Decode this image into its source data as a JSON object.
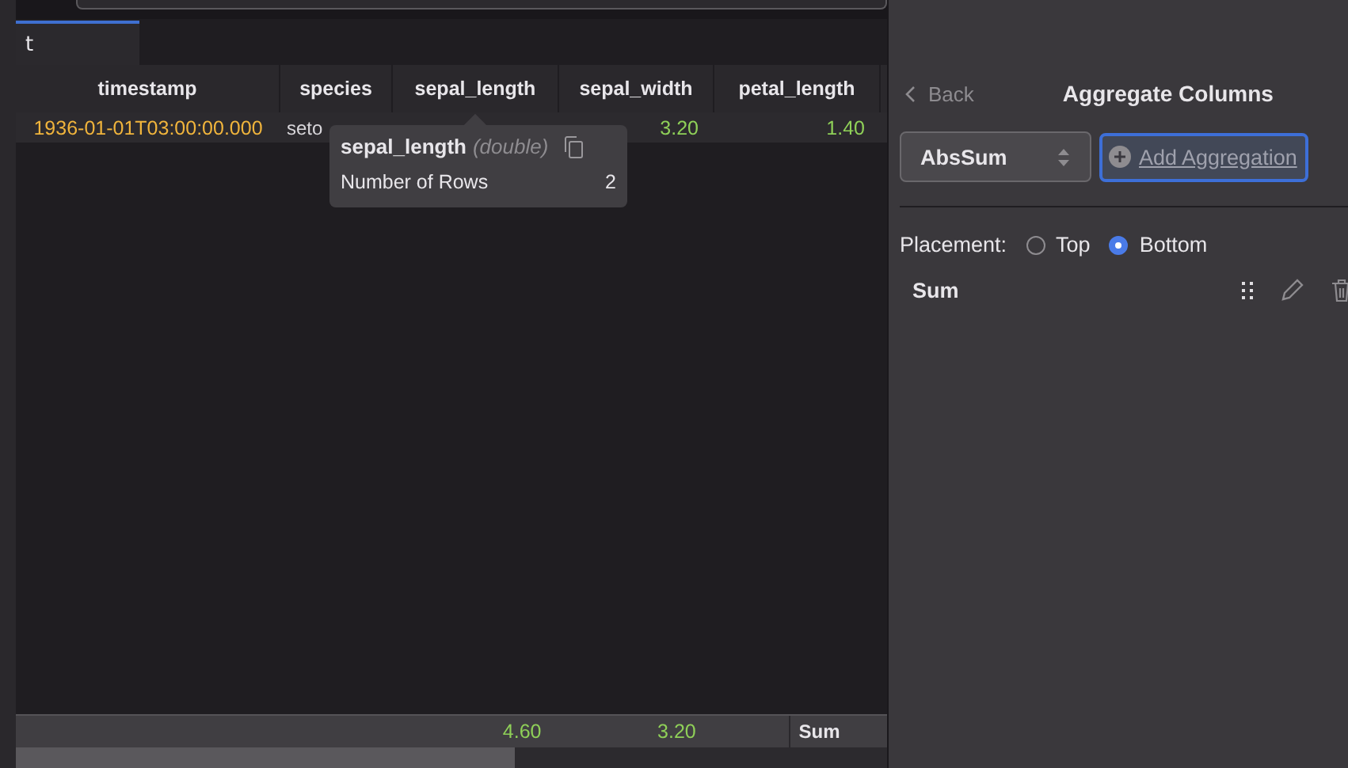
{
  "tabs": [
    {
      "label": "t",
      "selected": true
    }
  ],
  "table": {
    "columns": [
      {
        "label": "timestamp"
      },
      {
        "label": "species"
      },
      {
        "label": "sepal_length"
      },
      {
        "label": "sepal_width"
      },
      {
        "label": "petal_length"
      }
    ],
    "rows": [
      {
        "cells": [
          {
            "kind": "datetime",
            "text": "1936-01-01T03:00:00.000"
          },
          {
            "kind": "text",
            "text": "seto"
          },
          {
            "kind": "covered"
          },
          {
            "kind": "number",
            "text": "3.20"
          },
          {
            "kind": "number",
            "text": "1.40"
          }
        ]
      }
    ],
    "footer": {
      "cells": [
        {
          "kind": "blank"
        },
        {
          "kind": "blank"
        },
        {
          "kind": "number",
          "text": "4.60"
        },
        {
          "kind": "number",
          "text": "3.20"
        },
        {
          "kind": "blank"
        }
      ],
      "label": "Sum"
    }
  },
  "tooltip": {
    "column": "sepal_length",
    "type": "(double)",
    "stat_label": "Number of Rows",
    "stat_value": "2"
  },
  "panel": {
    "back": "Back",
    "title": "Aggregate Columns",
    "select": {
      "value": "AbsSum"
    },
    "add_button": "Add Aggregation",
    "placement": {
      "label": "Placement:",
      "options": [
        {
          "label": "Top",
          "selected": false
        },
        {
          "label": "Bottom",
          "selected": true
        }
      ]
    },
    "aggregations": [
      {
        "name": "Sum"
      }
    ]
  }
}
